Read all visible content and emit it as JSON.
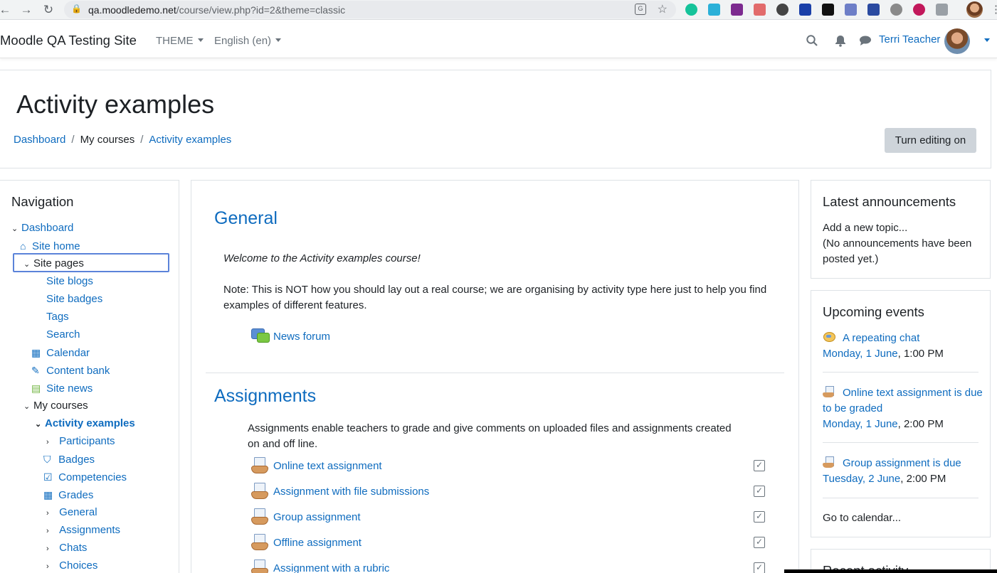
{
  "browser": {
    "url_host": "qa.moodledemo.net",
    "url_rest": "/course/view.php?id=2&theme=classic"
  },
  "header": {
    "brand": "Moodle QA Testing Site",
    "theme_menu": "THEME",
    "language_menu": "English (en)",
    "user_name": "Terri Teacher"
  },
  "page": {
    "title": "Activity examples",
    "breadcrumb": [
      "Dashboard",
      "My courses",
      "Activity examples"
    ],
    "edit_button": "Turn editing on"
  },
  "navigation": {
    "title": "Navigation",
    "items": [
      {
        "label": "Dashboard",
        "icon": "chevron-down-icon"
      },
      {
        "label": "Site home",
        "icon": "home-icon"
      },
      {
        "label": "Site pages",
        "icon": "chevron-down-icon"
      },
      {
        "label": "Site blogs",
        "icon": ""
      },
      {
        "label": "Site badges",
        "icon": ""
      },
      {
        "label": "Tags",
        "icon": ""
      },
      {
        "label": "Search",
        "icon": ""
      },
      {
        "label": "Calendar",
        "icon": "calendar-icon"
      },
      {
        "label": "Content bank",
        "icon": "brush-icon"
      },
      {
        "label": "Site news",
        "icon": "forum-icon"
      },
      {
        "label": "My courses",
        "icon": "chevron-down-icon"
      },
      {
        "label": "Activity examples",
        "icon": "chevron-down-icon"
      },
      {
        "label": "Participants",
        "icon": "chevron-right-icon"
      },
      {
        "label": "Badges",
        "icon": "shield-icon"
      },
      {
        "label": "Competencies",
        "icon": "checkbox-icon"
      },
      {
        "label": "Grades",
        "icon": "table-icon"
      },
      {
        "label": "General",
        "icon": "chevron-right-icon"
      },
      {
        "label": "Assignments",
        "icon": "chevron-right-icon"
      },
      {
        "label": "Chats",
        "icon": "chevron-right-icon"
      },
      {
        "label": "Choices",
        "icon": "chevron-right-icon"
      }
    ]
  },
  "main": {
    "general": {
      "heading": "General",
      "welcome": "Welcome to the Activity examples course!",
      "note": "Note: This is NOT how you should lay out a real course; we are organising by activity type here just to help you find examples of different features.",
      "forum": "News forum"
    },
    "assignments": {
      "heading": "Assignments",
      "summary": "Assignments enable teachers to grade and give comments on uploaded files and assignments created on and off line.",
      "items": [
        "Online text assignment",
        "Assignment with file submissions",
        "Group assignment",
        "Offline assignment",
        "Assignment with a rubric"
      ]
    }
  },
  "announcements": {
    "title": "Latest announcements",
    "add_link": "Add a new topic...",
    "empty": "(No announcements have been posted yet.)"
  },
  "events": {
    "title": "Upcoming events",
    "items": [
      {
        "name": "A repeating chat",
        "date": "Monday, 1 June",
        "time": ", 1:00 PM",
        "icon": "chat-icon"
      },
      {
        "name": "Online text assignment is due to be graded",
        "date": "Monday, 1 June",
        "time": ", 2:00 PM",
        "icon": "assignment-icon"
      },
      {
        "name": "Group assignment is due",
        "date": "Tuesday, 2 June",
        "time": ", 2:00 PM",
        "icon": "assignment-icon"
      }
    ],
    "calendar_link": "Go to calendar..."
  },
  "recent": {
    "title": "Recent activity"
  }
}
